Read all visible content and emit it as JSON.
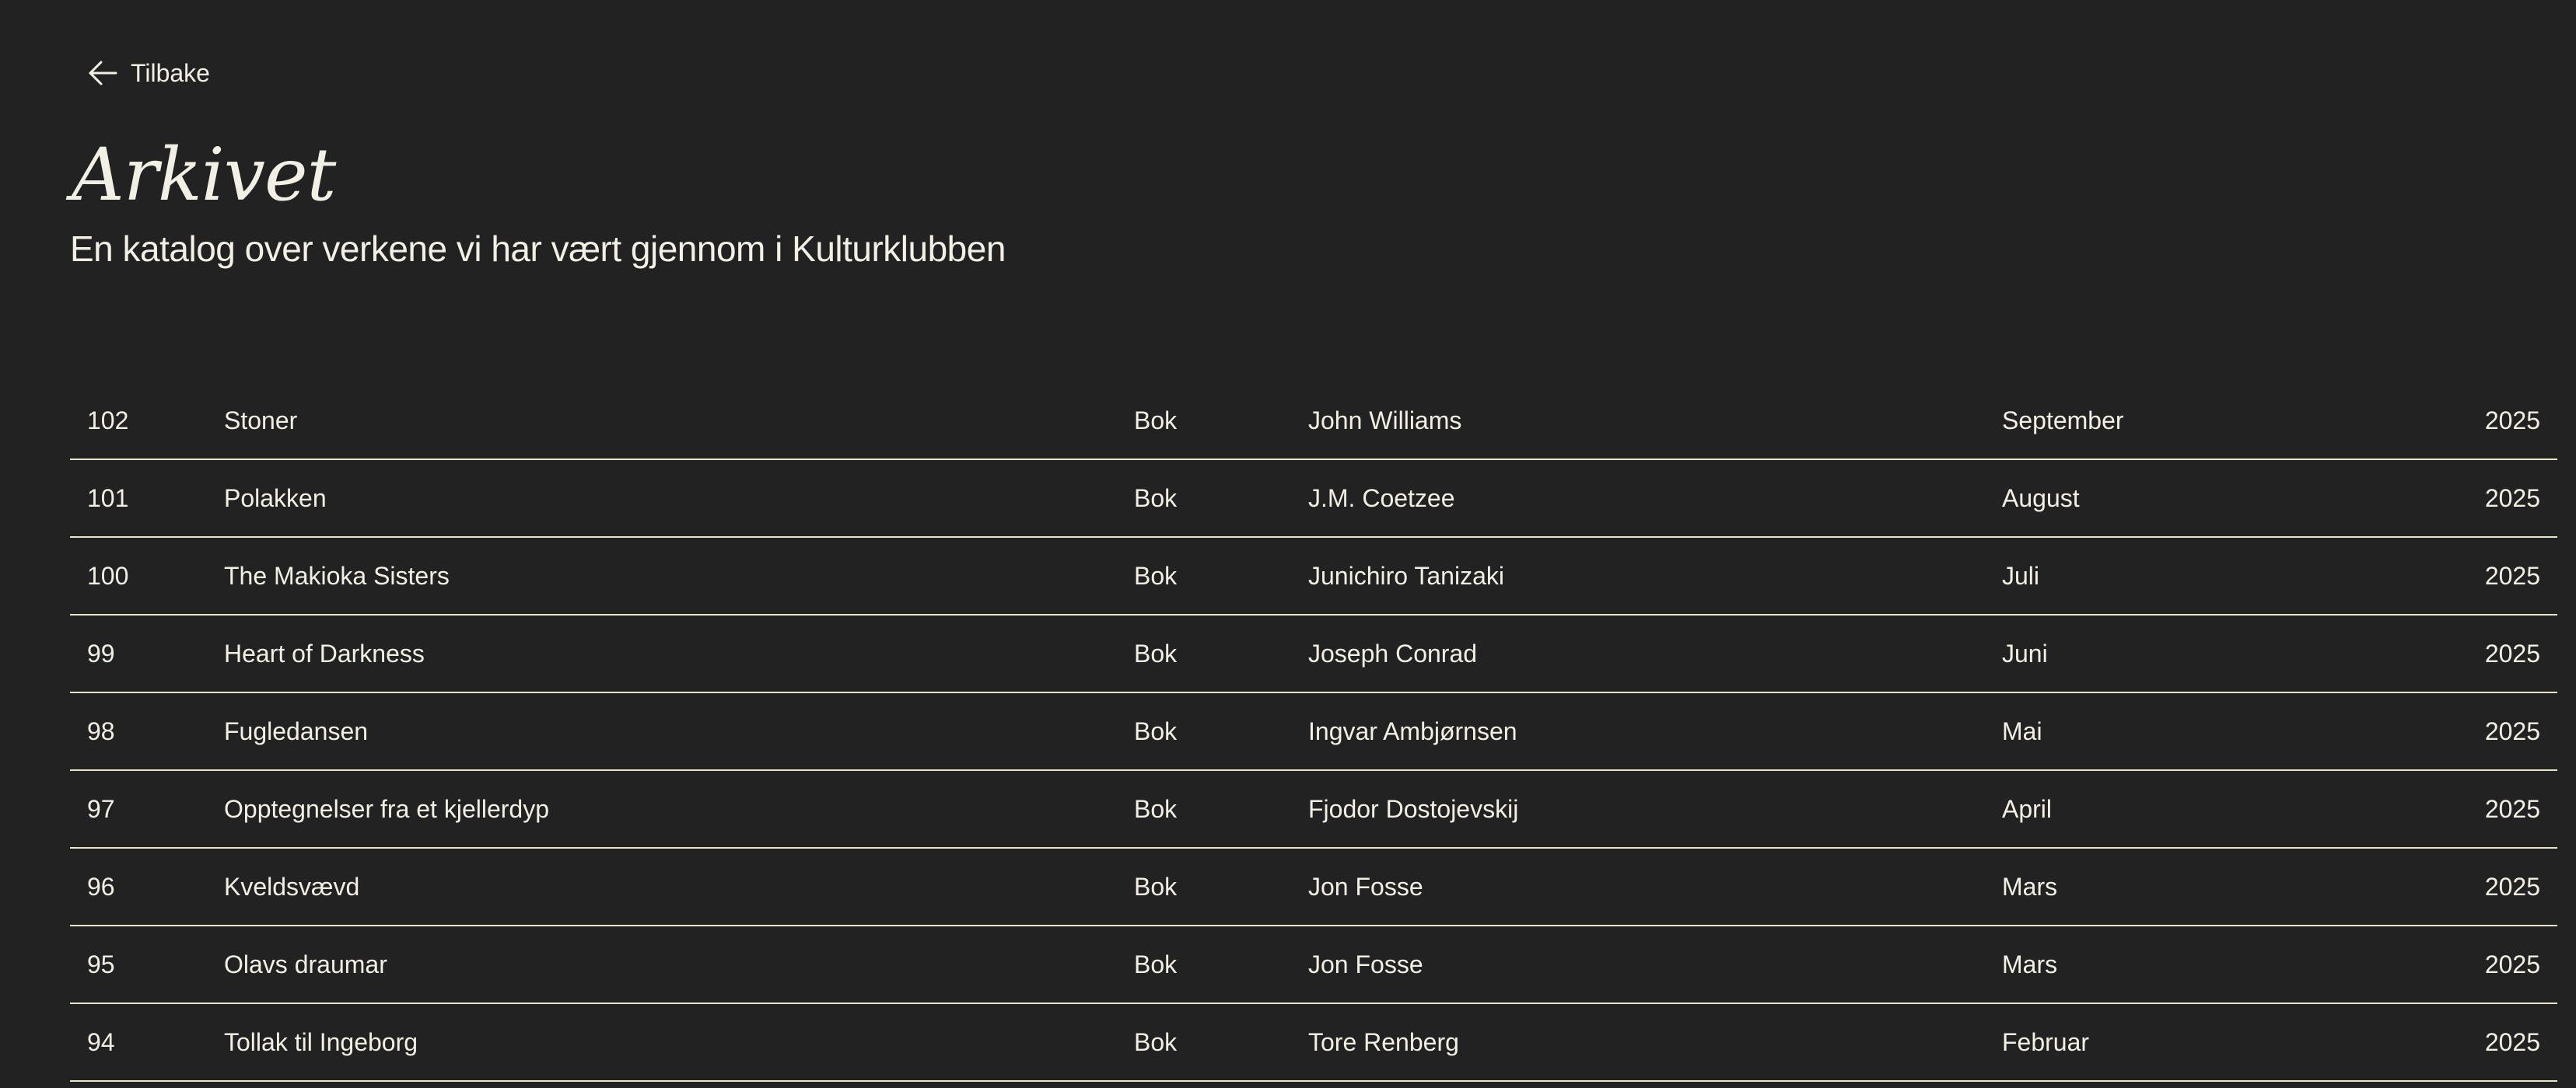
{
  "back": {
    "label": "Tilbake",
    "icon": "arrow-left-icon"
  },
  "header": {
    "title": "Arkivet",
    "subtitle": "En katalog over verkene vi har vært gjennom i Kulturklubben"
  },
  "archive": {
    "rows": [
      {
        "number": "102",
        "title": "Stoner",
        "type": "Bok",
        "author": "John Williams",
        "month": "September",
        "year": "2025"
      },
      {
        "number": "101",
        "title": "Polakken",
        "type": "Bok",
        "author": "J.M. Coetzee",
        "month": "August",
        "year": "2025"
      },
      {
        "number": "100",
        "title": "The Makioka Sisters",
        "type": "Bok",
        "author": "Junichiro Tanizaki",
        "month": "Juli",
        "year": "2025"
      },
      {
        "number": "99",
        "title": "Heart of Darkness",
        "type": "Bok",
        "author": "Joseph Conrad",
        "month": "Juni",
        "year": "2025"
      },
      {
        "number": "98",
        "title": "Fugledansen",
        "type": "Bok",
        "author": "Ingvar Ambjørnsen",
        "month": "Mai",
        "year": "2025"
      },
      {
        "number": "97",
        "title": "Opptegnelser fra et kjellerdyp",
        "type": "Bok",
        "author": "Fjodor Dostojevskij",
        "month": "April",
        "year": "2025"
      },
      {
        "number": "96",
        "title": "Kveldsvævd",
        "type": "Bok",
        "author": "Jon Fosse",
        "month": "Mars",
        "year": "2025"
      },
      {
        "number": "95",
        "title": "Olavs draumar",
        "type": "Bok",
        "author": "Jon Fosse",
        "month": "Mars",
        "year": "2025"
      },
      {
        "number": "94",
        "title": "Tollak til Ingeborg",
        "type": "Bok",
        "author": "Tore Renberg",
        "month": "Februar",
        "year": "2025"
      }
    ]
  }
}
